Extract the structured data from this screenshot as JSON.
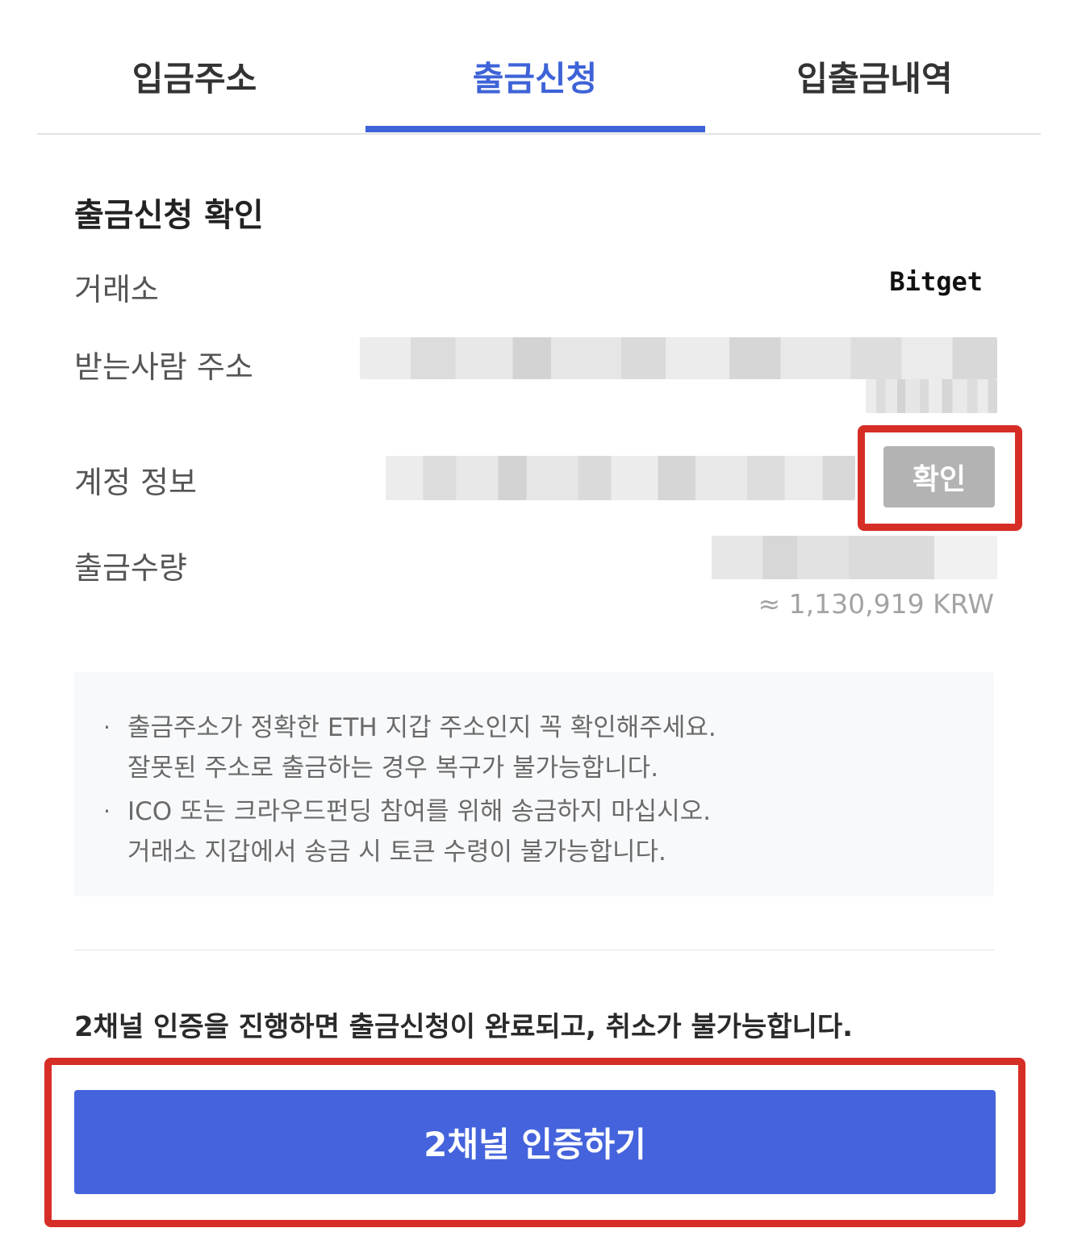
{
  "tabs": [
    {
      "label": "입금주소",
      "active": false
    },
    {
      "label": "출금신청",
      "active": true
    },
    {
      "label": "입출금내역",
      "active": false
    }
  ],
  "section_title": "출금신청 확인",
  "rows": {
    "exchange": {
      "label": "거래소",
      "value": "Bitget"
    },
    "recipient_address": {
      "label": "받는사람 주소"
    },
    "account_info": {
      "label": "계정 정보",
      "button_label": "확인"
    },
    "amount": {
      "label": "출금수량",
      "krw_approx": "≈ 1,130,919 KRW"
    }
  },
  "notices": [
    {
      "bullet": "·",
      "line1": "출금주소가 정확한 ETH 지갑 주소인지 꼭 확인해주세요.",
      "line2": "잘못된 주소로 출금하는 경우 복구가 불가능합니다."
    },
    {
      "bullet": "·",
      "line1": "ICO 또는 크라우드펀딩 참여를 위해 송금하지 마십시오.",
      "line2": "거래소 지갑에서 송금 시 토큰 수령이 불가능합니다."
    }
  ],
  "warning": "2채널 인증을 진행하면 출금신청이 완료되고, 취소가 불가능합니다.",
  "auth_button_label": "2채널 인증하기",
  "colors": {
    "accent": "#3e63d8",
    "button_blue": "#4463dc",
    "highlight_red": "#d62e26",
    "confirm_gray": "#b3b3b3"
  }
}
